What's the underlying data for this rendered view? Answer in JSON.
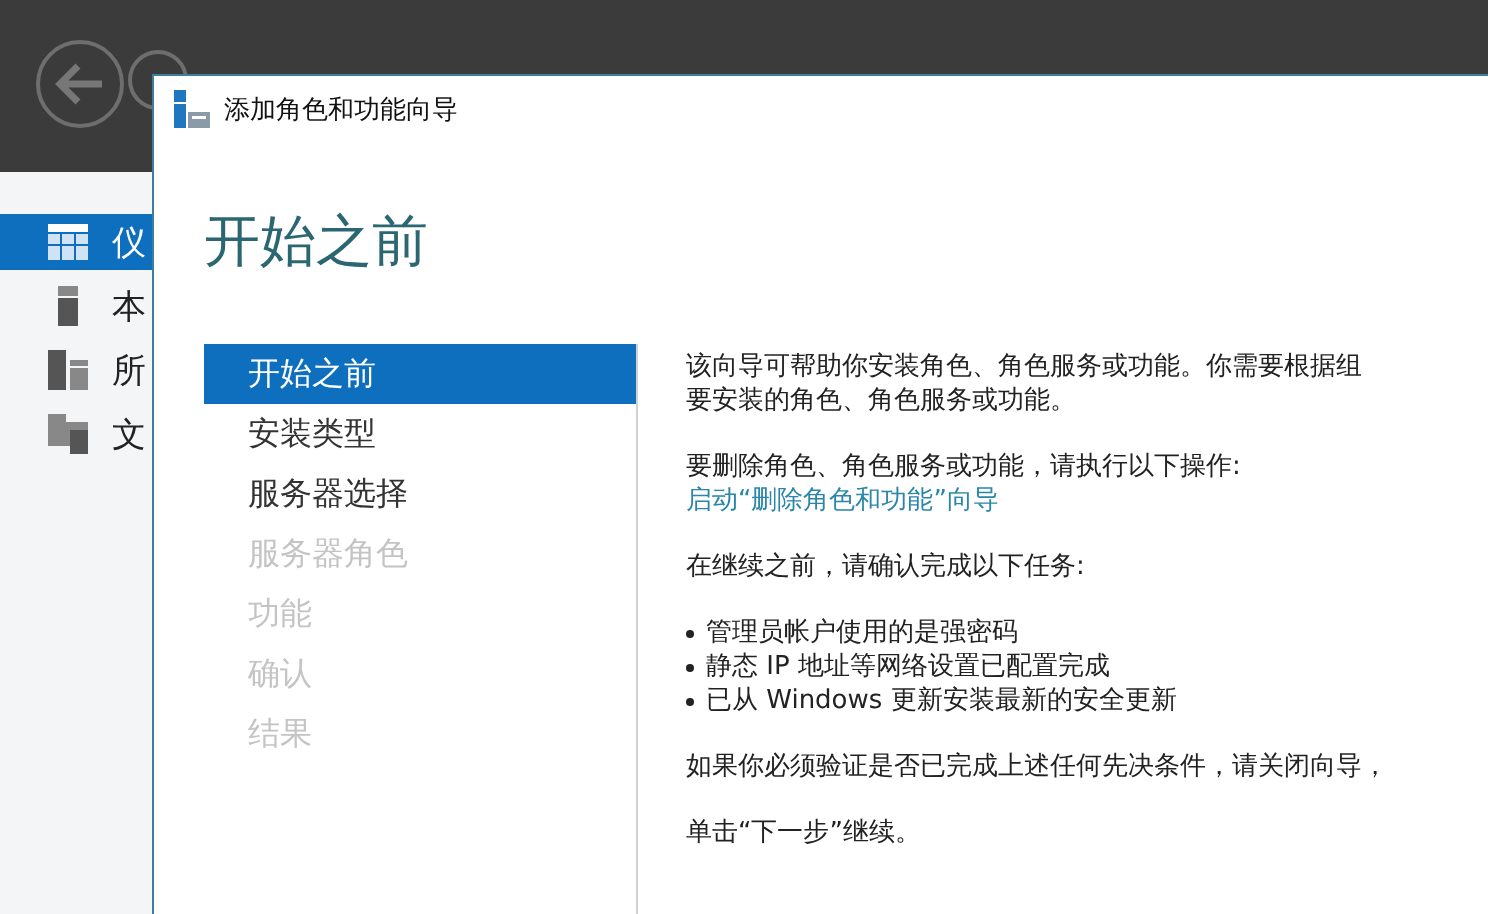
{
  "sidebar": {
    "items": [
      {
        "label": "仪",
        "selected": true
      },
      {
        "label": "本",
        "selected": false
      },
      {
        "label": "所",
        "selected": false
      },
      {
        "label": "文",
        "selected": false
      }
    ]
  },
  "dialog": {
    "title": "添加角色和功能向导",
    "heading": "开始之前",
    "steps": [
      {
        "label": "开始之前",
        "selected": true,
        "disabled": false
      },
      {
        "label": "安装类型",
        "selected": false,
        "disabled": false
      },
      {
        "label": "服务器选择",
        "selected": false,
        "disabled": false
      },
      {
        "label": "服务器角色",
        "selected": false,
        "disabled": true
      },
      {
        "label": "功能",
        "selected": false,
        "disabled": true
      },
      {
        "label": "确认",
        "selected": false,
        "disabled": true
      },
      {
        "label": "结果",
        "selected": false,
        "disabled": true
      }
    ],
    "content": [
      {
        "kind": "paragraph",
        "lines": [
          "该向导可帮助你安装角色、角色服务或功能。你需要根据组",
          "要安装的角色、角色服务或功能。"
        ]
      },
      {
        "kind": "paragraph",
        "lines": [
          "要删除角色、角色服务或功能，请执行以下操作:"
        ],
        "link": "启动“删除角色和功能”向导"
      },
      {
        "kind": "paragraph",
        "lines": [
          "在继续之前，请确认完成以下任务:"
        ]
      },
      {
        "kind": "bullets",
        "items": [
          "管理员帐户使用的是强密码",
          "静态 IP 地址等网络设置已配置完成",
          "已从 Windows 更新安装最新的安全更新"
        ]
      },
      {
        "kind": "paragraph",
        "lines": [
          "如果你必须验证是否已完成上述任何先决条件，请关闭向导，"
        ]
      },
      {
        "kind": "paragraph",
        "lines": [
          "单击“下一步”继续。"
        ]
      }
    ]
  }
}
